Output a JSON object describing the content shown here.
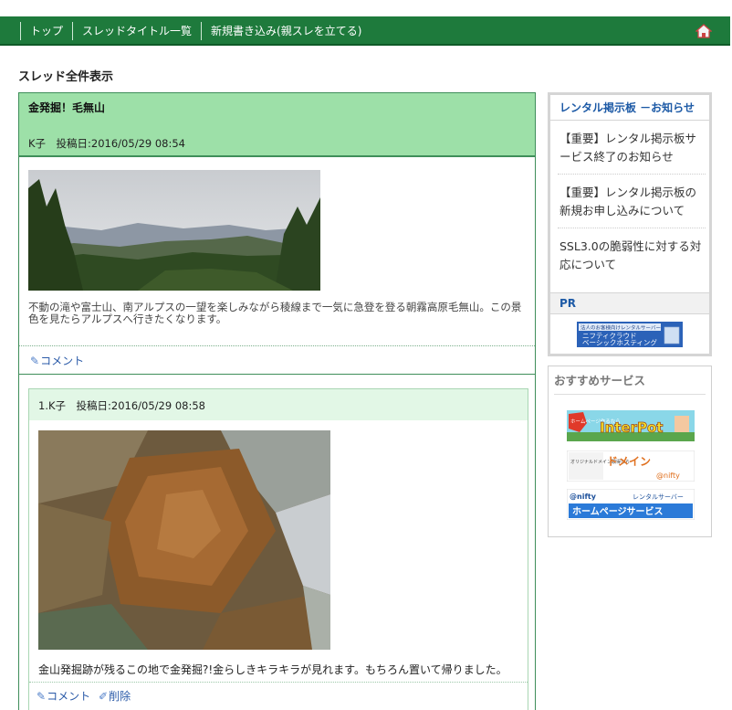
{
  "nav": {
    "items": [
      "トップ",
      "スレッドタイトル一覧",
      "新規書き込み(親スレを立てる)"
    ],
    "home_icon": "home-icon"
  },
  "page_title": "スレッド全件表示",
  "thread": {
    "title": "金発掘！毛無山",
    "meta": "K子　投稿日:2016/05/29 08:54",
    "body": "不動の滝や富士山、南アルプスの一望を楽しみながら稜線まで一気に急登を登る朝霧高原毛無山。この景色を見たらアルプスへ行きたくなります。",
    "comment_label": "コメント"
  },
  "reply": {
    "meta": "1.K子　投稿日:2016/05/29 08:58",
    "body": "金山発掘跡が残るこの地で金発掘?!金らしきキラキラが見れます。もちろん置いて帰りました。",
    "comment_label": "コメント",
    "delete_label": "削除"
  },
  "sidebar": {
    "notice_title": "レンタル掲示板 －お知らせ",
    "notices": [
      "【重要】レンタル掲示板サービス終了のお知らせ",
      "【重要】レンタル掲示板の新規お申し込みについて",
      "SSL3.0の脆弱性に対する対応について"
    ],
    "pr_label": "PR",
    "pr_banner": {
      "line1": "法人のお客様向けレンタルサーバー",
      "line2": "ニフティクラウド",
      "line3": "ベーシックホスティング"
    },
    "recommend_title": "おすすめサービス",
    "banners": {
      "interpot": {
        "badge": "ホームページ作るなら",
        "name": "InterPot"
      },
      "domain": {
        "left": "オリジナルドメイン取得なら",
        "name": "ドメイン",
        "sub": "@nifty"
      },
      "homepage": {
        "top_left": "@nifty",
        "top_right": "レンタルサーバー",
        "name": "ホームページサービス"
      }
    }
  },
  "colors": {
    "header": "#1e7a3c",
    "thread_head": "#9de0a8",
    "reply_head": "#e2f7e6",
    "link": "#2a5aa8"
  }
}
